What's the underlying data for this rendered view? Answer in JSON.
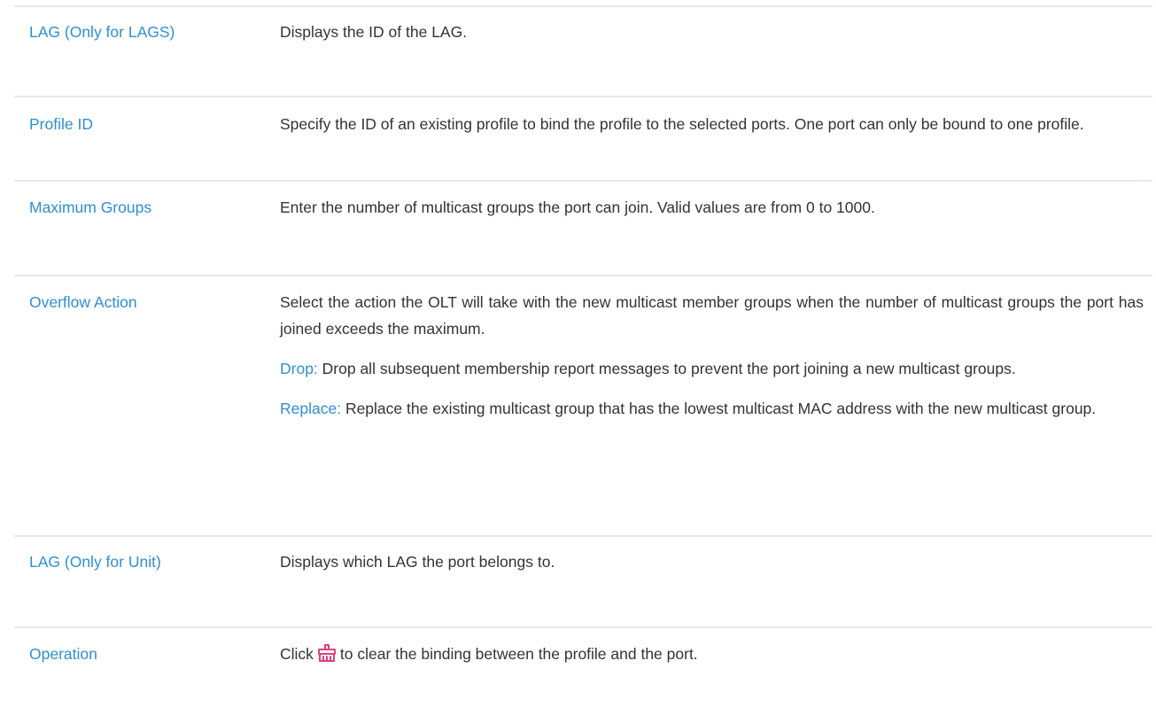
{
  "rows": [
    {
      "term": "LAG (Only for LAGS)",
      "desc": "Displays the ID of the LAG."
    },
    {
      "term": "Profile ID",
      "desc": "Specify the ID of an existing profile to bind the profile to the selected ports. One port can only be bound to one profile."
    },
    {
      "term": "Maximum Groups",
      "desc": "Enter the number of multicast groups the port can join. Valid values are from  0 to 1000."
    },
    {
      "term": "Overflow Action",
      "desc": "Select the action the OLT will take with the new multicast member groups when the number of multicast groups the port has joined exceeds the maximum.",
      "options": [
        {
          "name": "Drop:",
          "text": " Drop all subsequent membership report messages to prevent the port joining a new multicast groups."
        },
        {
          "name": "Replace:",
          "text": " Replace the existing multicast group that has the lowest multicast MAC address with the new multicast group."
        }
      ]
    },
    {
      "term": "LAG (Only for Unit)",
      "desc": "Displays which LAG the port belongs to."
    },
    {
      "term": "Operation",
      "desc_before": "Click",
      "icon": "clear-binding-icon",
      "desc_after": "to clear the binding between the profile and the port."
    }
  ],
  "colors": {
    "term": "#2f8fd0",
    "text": "#333333",
    "divider": "#e4e9ef",
    "icon": "#e0407a"
  }
}
